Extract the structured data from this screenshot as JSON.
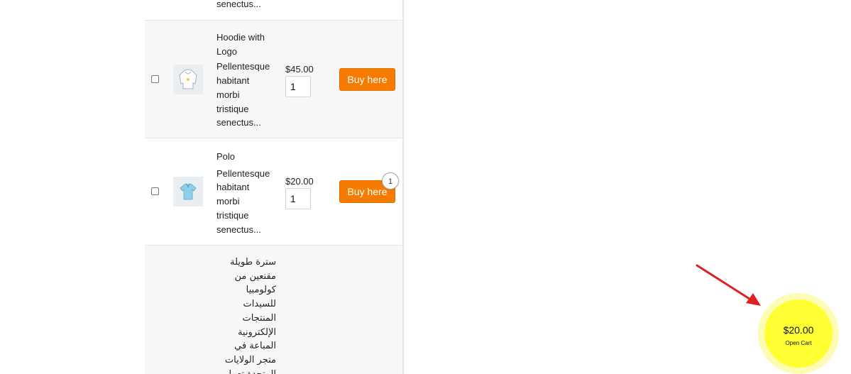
{
  "products": [
    {
      "desc_tail": "senectus..."
    },
    {
      "name_lines": [
        "Hoodie with",
        "Logo"
      ],
      "desc_lines": [
        "Pellentesque",
        "habitant",
        "morbi",
        "tristique",
        "senectus..."
      ],
      "price": "$45.00",
      "qty": "1",
      "button": "Buy here",
      "icon": "hoodie-icon"
    },
    {
      "name_lines": [
        "Polo"
      ],
      "desc_lines": [
        "Pellentesque",
        "habitant",
        "morbi",
        "tristique",
        "senectus..."
      ],
      "price": "$20.00",
      "qty": "1",
      "button": "Buy here",
      "badge": "1",
      "icon": "polo-shirt-icon"
    },
    {
      "lines": [
        "سترة طويلة",
        "مقنعين من",
        "كولومبيا",
        "للسيدات",
        "المنتجات",
        "الإلكترونية",
        "المباعة في",
        "متجر الولايات",
        "المتحدة تعمل"
      ]
    }
  ],
  "cart": {
    "total": "$20.00",
    "label": "Open Cart",
    "accent": "#ffff33",
    "halo": "#fdfcb4"
  },
  "annotation": {
    "arrow_color": "#e02020"
  },
  "button_color": "#f57c00"
}
